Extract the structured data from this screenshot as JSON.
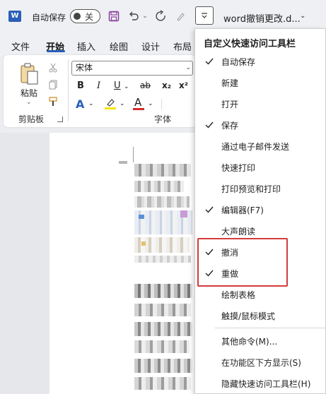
{
  "titlebar": {
    "app_logo": "W",
    "autosave_label": "自动保存",
    "toggle_state": "关",
    "doc_title": "word撤销更改.d...",
    "icons": [
      "save-icon",
      "undo-icon",
      "redo-icon",
      "format-painter-icon",
      "customize-qat-icon"
    ]
  },
  "tabs": [
    "文件",
    "开始",
    "插入",
    "绘图",
    "设计",
    "布局"
  ],
  "active_tab": "开始",
  "ribbon": {
    "paste_label": "粘贴",
    "clipboard_group": "剪贴板",
    "font_group": "字体",
    "font_name": "宋体",
    "bold": "B",
    "italic": "I",
    "underline": "U",
    "strike": "ab",
    "subscript": "x₂",
    "superscript": "x²",
    "text_effects": "A",
    "font_color": "A"
  },
  "menu": {
    "header": "自定义快速访问工具栏",
    "items": [
      {
        "label": "自动保存",
        "checked": true
      },
      {
        "label": "新建",
        "checked": false
      },
      {
        "label": "打开",
        "checked": false
      },
      {
        "label": "保存",
        "checked": true
      },
      {
        "label": "通过电子邮件发送",
        "checked": false
      },
      {
        "label": "快速打印",
        "checked": false
      },
      {
        "label": "打印预览和打印",
        "checked": false
      },
      {
        "label": "编辑器(F7)",
        "checked": true
      },
      {
        "label": "大声朗读",
        "checked": false
      },
      {
        "label": "撤消",
        "checked": true
      },
      {
        "label": "重做",
        "checked": true
      },
      {
        "label": "绘制表格",
        "checked": false
      },
      {
        "label": "触摸/鼠标模式",
        "checked": false
      },
      {
        "label": "其他命令(M)...",
        "checked": false
      },
      {
        "label": "在功能区下方显示(S)",
        "checked": false
      },
      {
        "label": "隐藏快速访问工具栏(H)",
        "checked": false
      }
    ]
  },
  "colors": {
    "accent": "#2b5fb8",
    "highlight_border": "#d43b3b",
    "highlight_yellow": "#f5e400",
    "font_red": "#d62b2b"
  }
}
